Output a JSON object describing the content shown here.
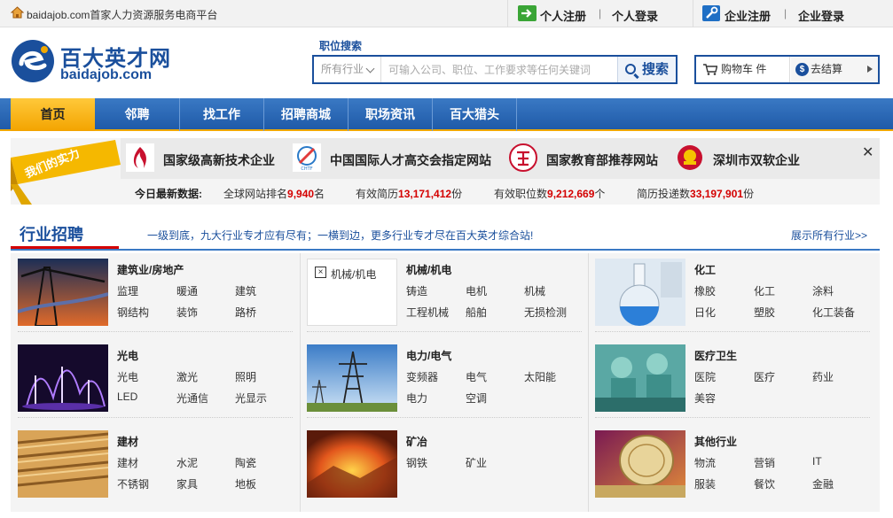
{
  "topbar": {
    "site_text": "baidajob.com首家人力资源服务电商平台",
    "personal_register": "个人注册",
    "personal_login": "个人登录",
    "corp_register": "企业注册",
    "corp_login": "企业登录",
    "separator": "|"
  },
  "header": {
    "logo_cn": "百大英才网",
    "logo_en": "baidajob.com",
    "search_tab": "职位搜索",
    "industry_placeholder": "所有行业",
    "search_placeholder": "可输入公司、职位、工作要求等任何关键词",
    "search_button": "搜索",
    "cart_label": "购物车 件",
    "checkout_label": "去结算",
    "coin_symbol": "$"
  },
  "nav": {
    "items": [
      {
        "label": "首页"
      },
      {
        "label": "邻聘"
      },
      {
        "label": "找工作"
      },
      {
        "label": "招聘商城"
      },
      {
        "label": "职场资讯"
      },
      {
        "label": "百大猎头"
      }
    ]
  },
  "banner": {
    "ribbon": "我们的实力",
    "certs": [
      {
        "label": "国家级高新技术企业"
      },
      {
        "label": "中国国际人才高交会指定网站"
      },
      {
        "label": "国家教育部推荐网站"
      },
      {
        "label": "深圳市双软企业"
      }
    ],
    "close": "✕",
    "stats_title": "今日最新数据:",
    "stats": [
      {
        "prefix": "全球网站排名",
        "value": "9,940",
        "suffix": "名"
      },
      {
        "prefix": "有效简历",
        "value": "13,171,412",
        "suffix": "份"
      },
      {
        "prefix": "有效职位数",
        "value": "9,212,669",
        "suffix": "个"
      },
      {
        "prefix": "简历投递数",
        "value": "33,197,901",
        "suffix": "份"
      }
    ]
  },
  "industry": {
    "title": "行业招聘",
    "slogan": "一级到底，九大行业专才应有尽有；一横到边，更多行业专才尽在百大英才综合站!",
    "more": "展示所有行业>>",
    "cells": [
      {
        "title": "建筑业/房地产",
        "subs": [
          "监理",
          "暖通",
          "建筑",
          "钢结构",
          "装饰",
          "路桥"
        ]
      },
      {
        "title": "机械/机电",
        "alt": "机械/机电",
        "subs": [
          "铸造",
          "电机",
          "机械",
          "工程机械",
          "船舶",
          "无损检测"
        ]
      },
      {
        "title": "化工",
        "subs": [
          "橡胶",
          "化工",
          "涂料",
          "日化",
          "塑胶",
          "化工装备"
        ]
      },
      {
        "title": "光电",
        "subs": [
          "光电",
          "激光",
          "照明",
          "LED",
          "光通信",
          "光显示"
        ]
      },
      {
        "title": "电力/电气",
        "subs": [
          "变频器",
          "电气",
          "太阳能",
          "电力",
          "空调"
        ]
      },
      {
        "title": "医疗卫生",
        "subs": [
          "医院",
          "医疗",
          "药业",
          "美容"
        ]
      },
      {
        "title": "建材",
        "subs": [
          "建材",
          "水泥",
          "陶瓷",
          "不锈钢",
          "家具",
          "地板"
        ]
      },
      {
        "title": "矿冶",
        "subs": [
          "钢铁",
          "矿业"
        ]
      },
      {
        "title": "其他行业",
        "subs": [
          "物流",
          "营销",
          "IT",
          "服装",
          "餐饮",
          "金融"
        ]
      }
    ]
  }
}
